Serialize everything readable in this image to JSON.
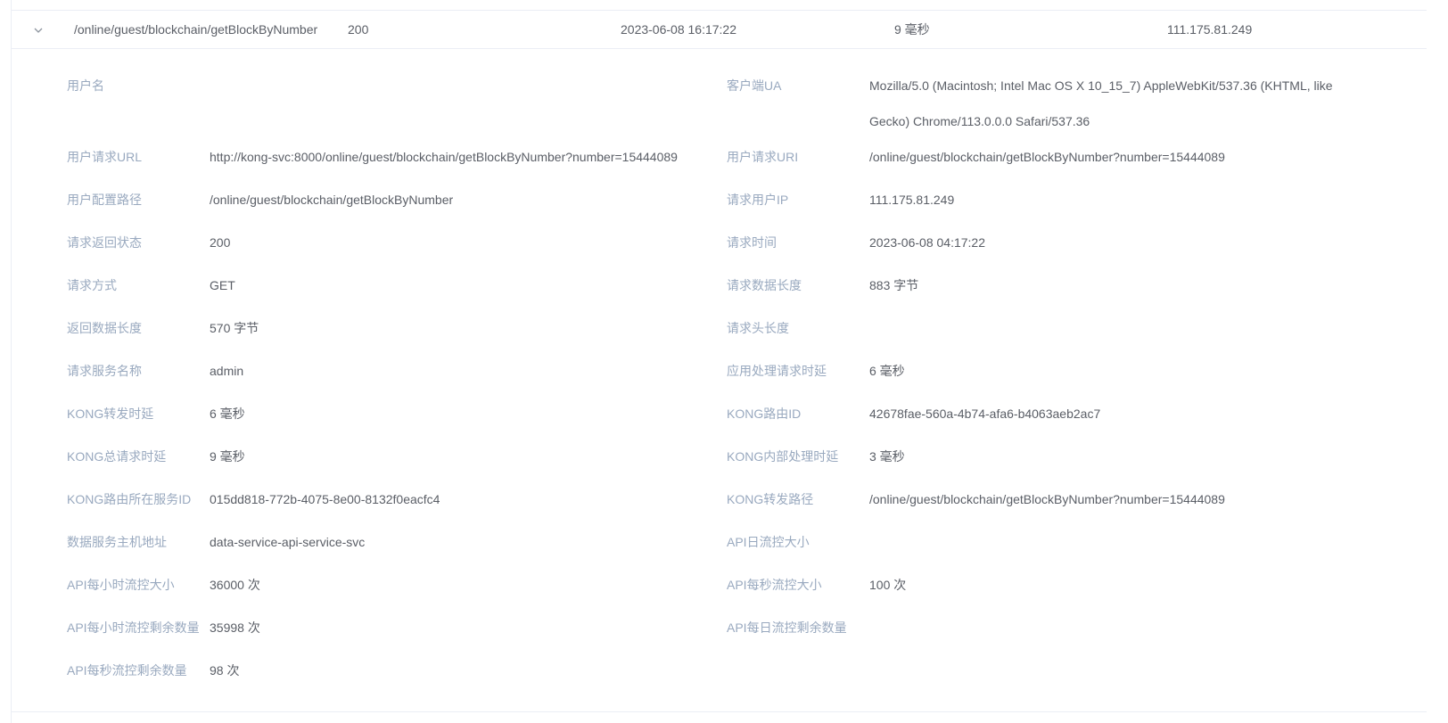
{
  "summary": {
    "path": "/online/guest/blockchain/getBlockByNumber",
    "status": "200",
    "time": "2023-06-08 16:17:22",
    "latency": "9 毫秒",
    "ip": "111.175.81.249"
  },
  "detail": {
    "left": [
      {
        "label": "用户名",
        "value": ""
      },
      {
        "label": "用户请求URL",
        "value": "http://kong-svc:8000/online/guest/blockchain/getBlockByNumber?number=15444089"
      },
      {
        "label": "用户配置路径",
        "value": "/online/guest/blockchain/getBlockByNumber"
      },
      {
        "label": "请求返回状态",
        "value": "200"
      },
      {
        "label": "请求方式",
        "value": "GET"
      },
      {
        "label": "返回数据长度",
        "value": "570 字节"
      },
      {
        "label": "请求服务名称",
        "value": "admin"
      },
      {
        "label": "KONG转发时延",
        "value": "6 毫秒"
      },
      {
        "label": "KONG总请求时延",
        "value": "9 毫秒"
      },
      {
        "label": "KONG路由所在服务ID",
        "value": "015dd818-772b-4075-8e00-8132f0eacfc4"
      },
      {
        "label": "数据服务主机地址",
        "value": "data-service-api-service-svc"
      },
      {
        "label": "API每小时流控大小",
        "value": "36000 次"
      },
      {
        "label": "API每小时流控剩余数量",
        "value": "35998 次"
      },
      {
        "label": "API每秒流控剩余数量",
        "value": "98 次"
      }
    ],
    "right": [
      {
        "label": "客户端UA",
        "value": "Mozilla/5.0 (Macintosh; Intel Mac OS X 10_15_7) AppleWebKit/537.36 (KHTML, like Gecko) Chrome/113.0.0.0 Safari/537.36"
      },
      {
        "label": "用户请求URI",
        "value": "/online/guest/blockchain/getBlockByNumber?number=15444089"
      },
      {
        "label": "请求用户IP",
        "value": "111.175.81.249"
      },
      {
        "label": "请求时间",
        "value": "2023-06-08 04:17:22"
      },
      {
        "label": "请求数据长度",
        "value": "883 字节"
      },
      {
        "label": "请求头长度",
        "value": ""
      },
      {
        "label": "应用处理请求时延",
        "value": "6 毫秒"
      },
      {
        "label": "KONG路由ID",
        "value": "42678fae-560a-4b74-afa6-b4063aeb2ac7"
      },
      {
        "label": "KONG内部处理时延",
        "value": "3 毫秒"
      },
      {
        "label": "KONG转发路径",
        "value": "/online/guest/blockchain/getBlockByNumber?number=15444089"
      },
      {
        "label": "API日流控大小",
        "value": ""
      },
      {
        "label": "API每秒流控大小",
        "value": "100 次"
      },
      {
        "label": "API每日流控剩余数量",
        "value": ""
      }
    ]
  }
}
